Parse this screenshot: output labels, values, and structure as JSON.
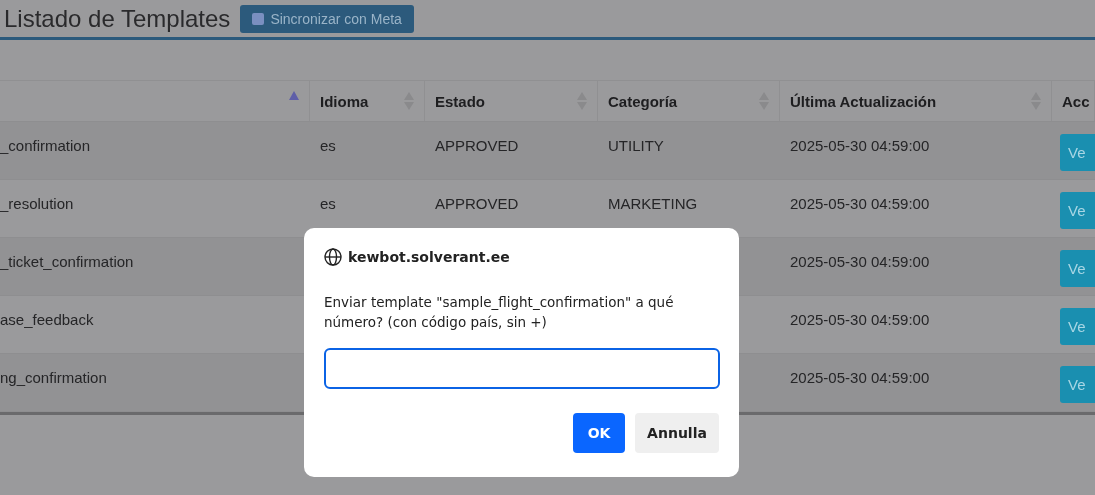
{
  "page": {
    "title": "Listado de Templates",
    "sync_button": "Sincronizar con Meta"
  },
  "table": {
    "columns": [
      {
        "sorted": true
      },
      {
        "label": "Idioma",
        "sorted": false
      },
      {
        "label": "Estado",
        "sorted": false
      },
      {
        "label": "Categoría",
        "sorted": false
      },
      {
        "label": "Última Actualización",
        "sorted": false
      },
      {
        "label": "Acc"
      }
    ],
    "rows": [
      {
        "cells": [
          "_confirmation",
          "es",
          "APPROVED",
          "UTILITY",
          "2025-05-30 04:59:00"
        ],
        "action": "Ve"
      },
      {
        "cells": [
          "_resolution",
          "es",
          "APPROVED",
          "MARKETING",
          "2025-05-30 04:59:00"
        ],
        "action": "Ve"
      },
      {
        "cells": [
          "_ticket_confirmation",
          null,
          null,
          null,
          "2025-05-30 04:59:00"
        ],
        "action": "Ve"
      },
      {
        "cells": [
          "ase_feedback",
          null,
          null,
          null,
          "2025-05-30 04:59:00"
        ],
        "action": "Ve"
      },
      {
        "cells": [
          "ng_confirmation",
          null,
          null,
          null,
          "2025-05-30 04:59:00"
        ],
        "action": "Ve"
      }
    ]
  },
  "dialog": {
    "origin": "kewbot.solverant.ee",
    "message": "Enviar template \"sample_flight_confirmation\" a qué número? (con código país, sin +)",
    "ok": "OK",
    "cancel": "Annulla"
  }
}
